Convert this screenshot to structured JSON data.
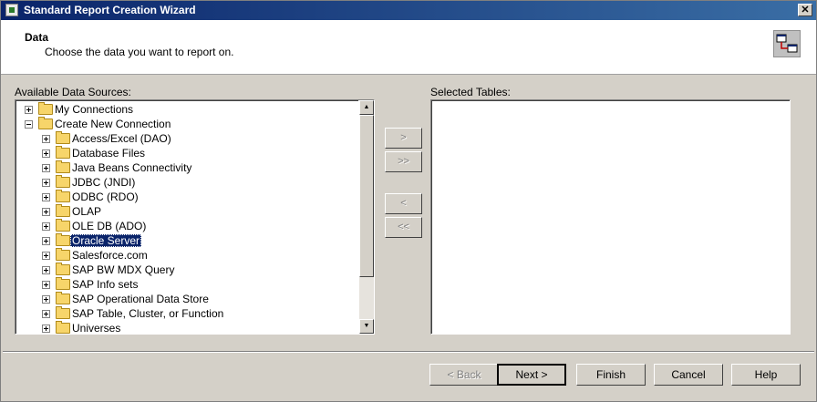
{
  "window": {
    "title": "Standard Report Creation Wizard",
    "close_label": "✕"
  },
  "header": {
    "title": "Data",
    "subtitle": "Choose the data you want to report on."
  },
  "left": {
    "label": "Available Data Sources:"
  },
  "right": {
    "label": "Selected Tables:"
  },
  "tree": {
    "items": [
      {
        "label": "My Connections",
        "level": 0,
        "expander": "plus"
      },
      {
        "label": "Create New Connection",
        "level": 0,
        "expander": "minus"
      },
      {
        "label": "Access/Excel (DAO)",
        "level": 1,
        "expander": "plus"
      },
      {
        "label": "Database Files",
        "level": 1,
        "expander": "plus"
      },
      {
        "label": "Java Beans Connectivity",
        "level": 1,
        "expander": "plus"
      },
      {
        "label": "JDBC (JNDI)",
        "level": 1,
        "expander": "plus"
      },
      {
        "label": "ODBC (RDO)",
        "level": 1,
        "expander": "plus"
      },
      {
        "label": "OLAP",
        "level": 1,
        "expander": "plus"
      },
      {
        "label": "OLE DB (ADO)",
        "level": 1,
        "expander": "plus"
      },
      {
        "label": "Oracle Server",
        "level": 1,
        "expander": "plus",
        "selected": true
      },
      {
        "label": "Salesforce.com",
        "level": 1,
        "expander": "plus"
      },
      {
        "label": "SAP BW MDX Query",
        "level": 1,
        "expander": "plus"
      },
      {
        "label": "SAP Info sets",
        "level": 1,
        "expander": "plus"
      },
      {
        "label": "SAP Operational Data Store",
        "level": 1,
        "expander": "plus"
      },
      {
        "label": "SAP Table, Cluster, or Function",
        "level": 1,
        "expander": "plus"
      },
      {
        "label": "Universes",
        "level": 1,
        "expander": "plus"
      }
    ]
  },
  "transfer": {
    "add_one": ">",
    "add_all": ">>",
    "remove_one": "<",
    "remove_all": "<<"
  },
  "buttons": {
    "back": "< Back",
    "next": "Next >",
    "finish": "Finish",
    "cancel": "Cancel",
    "help": "Help"
  }
}
